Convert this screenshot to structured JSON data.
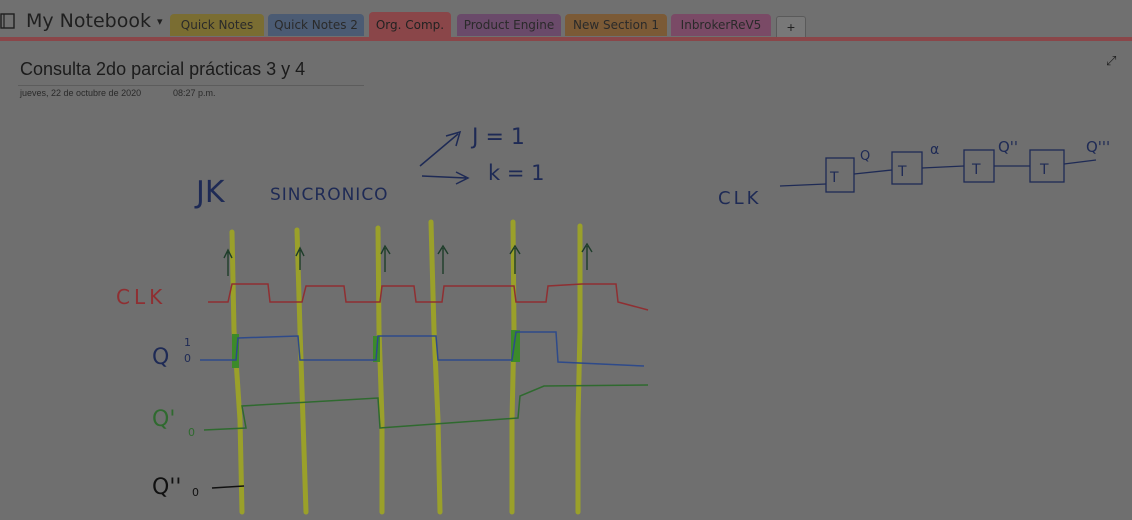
{
  "notebook": {
    "name": "My Notebook",
    "caret": "▾"
  },
  "tabs": [
    {
      "label": "Quick Notes",
      "color": "#7a6d32",
      "active": false
    },
    {
      "label": "Quick Notes 2",
      "color": "#4b5b73",
      "active": false
    },
    {
      "label": "Org. Comp.",
      "color": "#8a4649",
      "active": true
    },
    {
      "label": "Product Engine",
      "color": "#6a4a6a",
      "active": false
    },
    {
      "label": "New Section 1",
      "color": "#7b5a36",
      "active": false
    },
    {
      "label": "InbrokerReV5",
      "color": "#7a4a66",
      "active": false
    }
  ],
  "add_tab": "+",
  "page": {
    "title": "Consulta 2do parcial prácticas 3 y 4",
    "date": "jueves, 22 de octubre de 2020",
    "time": "08:27 p.m.",
    "expand_icon": "⤢"
  },
  "ink_text": {
    "jk": "JK",
    "sincronico": "SINCRONICO",
    "j_eq": "J = 1",
    "k_eq": "k = 1",
    "clk_left": "CLK",
    "clk_right": "CLK",
    "q_label": "Q",
    "q1_label": "Q'",
    "q2_label": "Q''",
    "one": "1",
    "zero": "0",
    "t": "T",
    "alpha": "α",
    "q3_label": "Q'''"
  },
  "colors": {
    "clk": "#8f2f32",
    "q": "#2e4a8a",
    "q1": "#2f6a2f",
    "marker": "#9aa02a",
    "ink": "#1e2a55",
    "ink_dark": "#111"
  }
}
